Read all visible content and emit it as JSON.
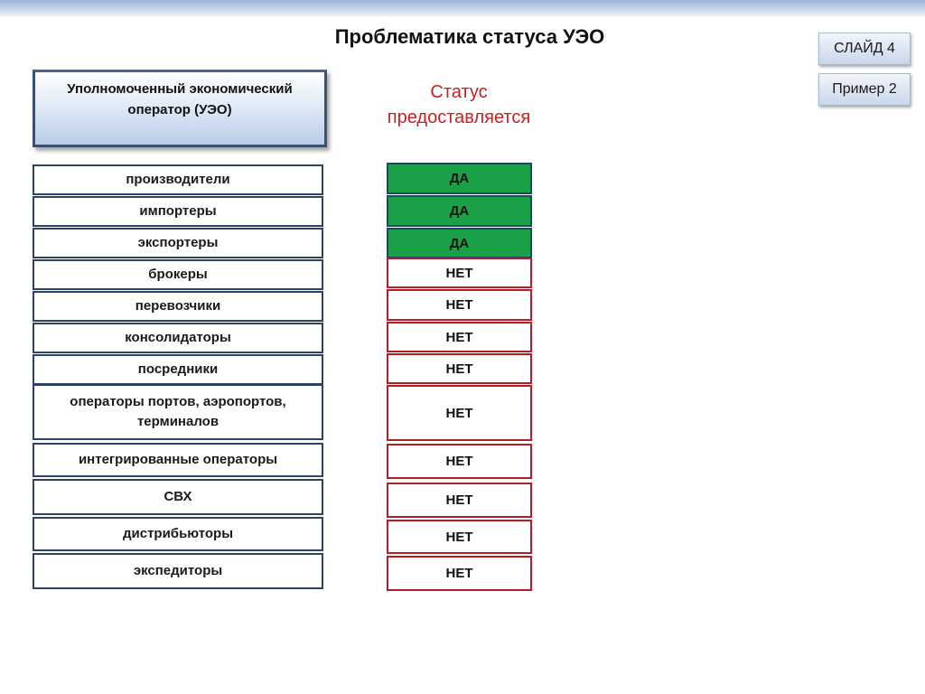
{
  "header": {
    "title": "Проблематика статуса УЭО"
  },
  "nav": {
    "slide_label": "СЛАЙД 4",
    "example_label": "Пример 2"
  },
  "operator": {
    "label": "Уполномоченный экономический оператор (УЭО)"
  },
  "status_header": {
    "label": "Статус предоставляется"
  },
  "colors": {
    "yes_fill": "#1aa046",
    "no_border": "#b51e24",
    "category_border": "#2d4263",
    "status_text": "#cc1f1f"
  },
  "rows": [
    {
      "category": "производители",
      "status": "ДА"
    },
    {
      "category": "импортеры",
      "status": "ДА"
    },
    {
      "category": "экспортеры",
      "status": "ДА"
    },
    {
      "category": "брокеры",
      "status": "НЕТ"
    },
    {
      "category": "перевозчики",
      "status": "НЕТ"
    },
    {
      "category": "консолидаторы",
      "status": "НЕТ"
    },
    {
      "category": "посредники",
      "status": "НЕТ"
    },
    {
      "category": "операторы портов, аэропортов, терминалов",
      "status": "НЕТ"
    },
    {
      "category": "интегрированные операторы",
      "status": "НЕТ"
    },
    {
      "category": "СВХ",
      "status": "НЕТ"
    },
    {
      "category": "дистрибьюторы",
      "status": "НЕТ"
    },
    {
      "category": "экспедиторы",
      "status": "НЕТ"
    }
  ]
}
